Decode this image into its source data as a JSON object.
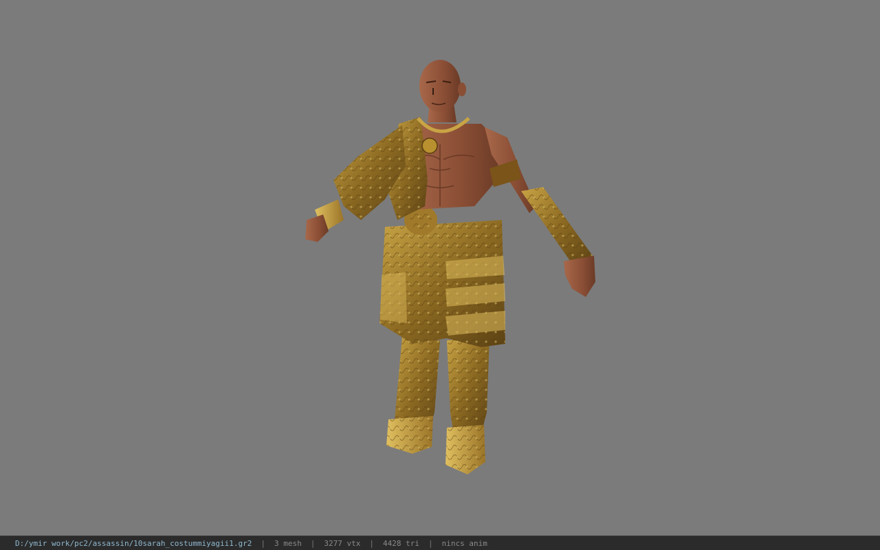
{
  "status": {
    "file_path": "D:/ymir work/pc2/assassin/10sarah_costummiyagii1.gr2",
    "separator": "|",
    "mesh_count": "3 mesh",
    "vertex_count": "3277 vtx",
    "triangle_count": "4428 tri",
    "anim_status": "nincs anim"
  },
  "colors": {
    "background": "#7b7b7b",
    "status_bar": "#2b2b2b",
    "path_text": "#8fb8cf",
    "stat_text": "#8a8a8a"
  }
}
